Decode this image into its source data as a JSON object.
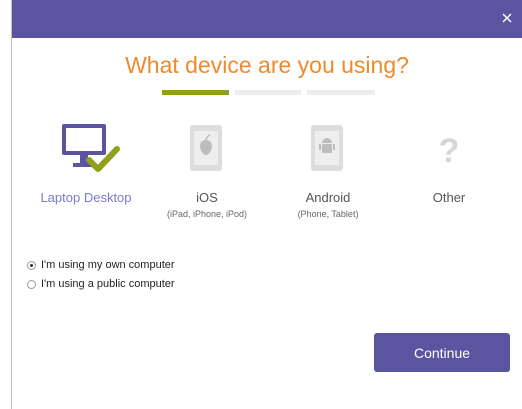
{
  "header": {
    "close_label": "×"
  },
  "title": "What device are you using?",
  "progress_steps": [
    {
      "state": "active",
      "color": "#8fa11a"
    },
    {
      "state": "inactive",
      "color": "#ececec"
    },
    {
      "state": "inactive",
      "color": "#ececec"
    }
  ],
  "devices": [
    {
      "label": "Laptop Desktop",
      "sub": "",
      "icon": "laptop-desktop-check-icon",
      "selected": true
    },
    {
      "label": "iOS",
      "sub": "(iPad, iPhone, iPod)",
      "icon": "ios-tablet-icon",
      "selected": false
    },
    {
      "label": "Android",
      "sub": "(Phone, Tablet)",
      "icon": "android-tablet-icon",
      "selected": false
    },
    {
      "label": "Other",
      "sub": "",
      "icon": "question-mark-icon",
      "selected": false
    }
  ],
  "options": [
    {
      "label": "I'm using my own computer",
      "checked": true
    },
    {
      "label": "I'm using a public computer",
      "checked": false
    }
  ],
  "continue_label": "Continue",
  "colors": {
    "header": "#5b54a0",
    "title": "#ef8a2a",
    "accent_green": "#8fa11a",
    "button": "#5b54a0",
    "selected_label": "#7a7acb"
  }
}
